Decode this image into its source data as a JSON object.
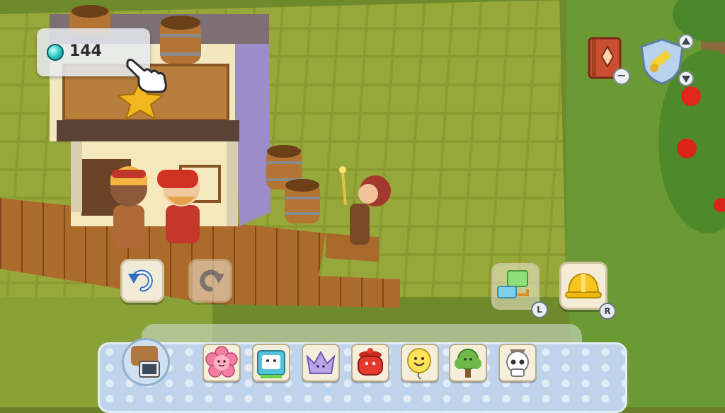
{
  "hud": {
    "gem_count": "144",
    "gem_icon": "gem-icon",
    "pointer_icon": "pointing-hand-cursor-icon"
  },
  "toolbar": {
    "undo_icon": "undo-arrow-icon",
    "redo_icon": "redo-arrow-icon",
    "book_icon": "recipe-book-icon",
    "minus_label": "−",
    "tool_icon": "paint-brush-icon",
    "build_button_badge": "L",
    "helmet_button_badge": "R"
  },
  "categories": [
    {
      "name": "flower",
      "icon": "flower-face-icon",
      "color": "#f37da0"
    },
    {
      "name": "tv",
      "icon": "tv-robot-icon",
      "color": "#52c3d9"
    },
    {
      "name": "crown",
      "icon": "crown-icon",
      "color": "#b9a4e8"
    },
    {
      "name": "pot",
      "icon": "cooking-pot-icon",
      "color": "#e23a2c"
    },
    {
      "name": "balloon",
      "icon": "smiley-balloon-icon",
      "color": "#ffe258"
    },
    {
      "name": "tree",
      "icon": "tree-icon",
      "color": "#6fb84a"
    },
    {
      "name": "skull",
      "icon": "skull-icon",
      "color": "#ffffff"
    }
  ],
  "colors": {
    "grass": "#8a9a32",
    "grid_line": "#4d5c1c",
    "deck": "#a8662a",
    "tray": "#bfd4ea"
  }
}
